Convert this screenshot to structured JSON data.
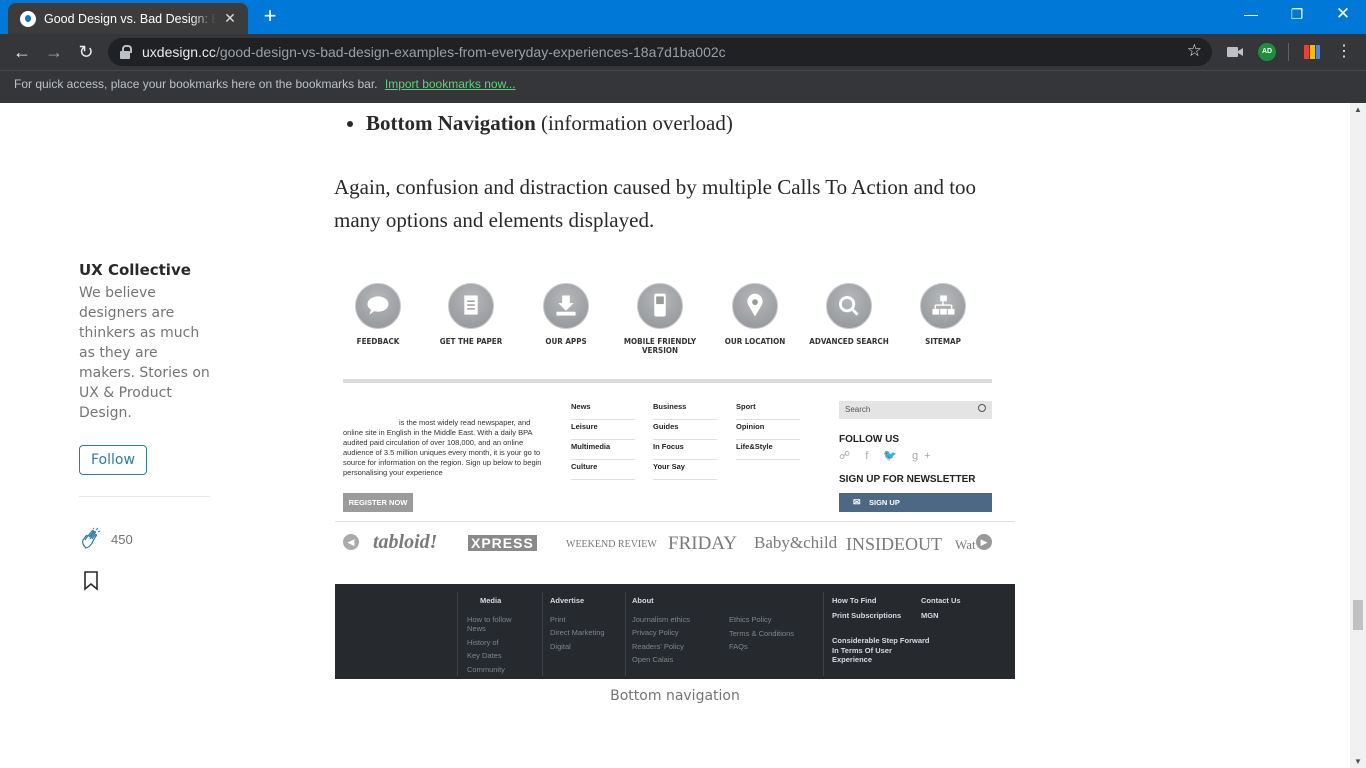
{
  "browser": {
    "tab_title": "Good Design vs. Bad Design: Exa",
    "url_host": "uxdesign.cc",
    "url_path": "/good-design-vs-bad-design-examples-from-everyday-experiences-18a7d1ba002c",
    "bookmarks_text": "For quick access, place your bookmarks here on the bookmarks bar.",
    "bookmarks_link": "Import bookmarks now...",
    "profile_initials": "AD"
  },
  "article": {
    "bullet_bold": "Bottom Navigation",
    "bullet_rest": " (information overload)",
    "paragraph": "Again, confusion and distraction caused by multiple Calls To Action and too many options and elements displayed.",
    "caption": "Bottom navigation"
  },
  "sidebar": {
    "publication": "UX Collective",
    "description": "We believe designers are thinkers as much as they are makers. Stories on UX & Product Design.",
    "follow_label": "Follow",
    "clap_count": "450"
  },
  "figure": {
    "icons": [
      "FEEDBACK",
      "GET THE PAPER",
      "OUR APPS",
      "MOBILE FRIENDLY VERSION",
      "OUR LOCATION",
      "ADVANCED SEARCH",
      "SITEMAP"
    ],
    "about_text": "is the most widely read newspaper, and online site in English in the Middle East. With a daily BPA audited paid circulation of over 108,000, and an online audience of 3.5 million uniques every month, it is your go to source for information on the region. Sign up below to begin personalising your experience",
    "register_label": "REGISTER NOW",
    "link_cols": [
      [
        "News",
        "Leisure",
        "Multimedia",
        "Culture"
      ],
      [
        "Business",
        "Guides",
        "In Focus",
        "Your Say"
      ],
      [
        "Sport",
        "Opinion",
        "Life&Style"
      ]
    ],
    "search_placeholder": "Search",
    "follow_us": "FOLLOW US",
    "newsletter": "SIGN UP FOR NEWSLETTER",
    "signup_label": "SIGN UP",
    "brands": [
      "tabloid!",
      "XPRESS",
      "WEEKEND REVIEW",
      "FRIDAY",
      "Baby&child",
      "INSIDEOUT",
      "Wat"
    ],
    "footer": {
      "media": {
        "h": "Media",
        "items": [
          "How to follow",
          "News",
          "History of",
          "Key Dates",
          "Community"
        ]
      },
      "advertise": {
        "h": "Advertise",
        "items": [
          "Print",
          "Direct Marketing",
          "Digital"
        ]
      },
      "about": {
        "h": "About",
        "items": [
          "Journalism ethics",
          "Privacy Policy",
          "Readers' Policy",
          "Open Calais"
        ]
      },
      "policies": {
        "items": [
          "Ethics Policy",
          "Terms & Conditions",
          "FAQs"
        ]
      },
      "howtofind": {
        "h": "How To Find",
        "w": "Print Subscriptions",
        "w2": "Considerable Step Forward In Terms Of User Experience"
      },
      "contact": {
        "h": "Contact Us",
        "w": "MGN"
      }
    }
  }
}
